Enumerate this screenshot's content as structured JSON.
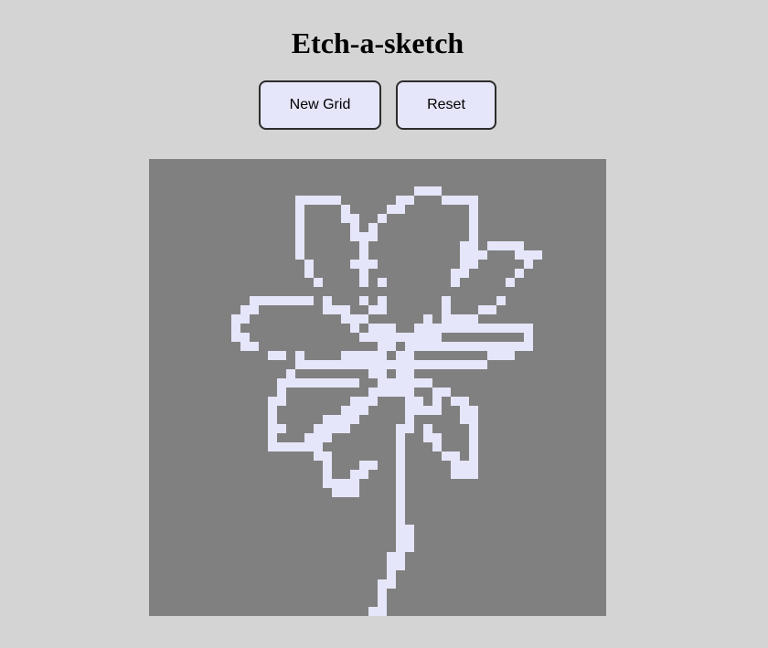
{
  "page": {
    "title": "Etch-a-sketch"
  },
  "controls": {
    "new_grid_label": "New Grid",
    "reset_label": "Reset"
  },
  "grid": {
    "columns": 50,
    "rows": 50,
    "background_color": "#808080",
    "ink_color": "#e6e6fa",
    "painted_cells": [
      [
        16,
        4
      ],
      [
        17,
        4
      ],
      [
        18,
        4
      ],
      [
        19,
        4
      ],
      [
        20,
        4
      ],
      [
        29,
        3
      ],
      [
        30,
        3
      ],
      [
        31,
        3
      ],
      [
        27,
        4
      ],
      [
        28,
        4
      ],
      [
        32,
        4
      ],
      [
        33,
        4
      ],
      [
        34,
        4
      ],
      [
        35,
        4
      ],
      [
        16,
        5
      ],
      [
        21,
        5
      ],
      [
        26,
        5
      ],
      [
        27,
        5
      ],
      [
        35,
        5
      ],
      [
        16,
        6
      ],
      [
        21,
        6
      ],
      [
        22,
        6
      ],
      [
        25,
        6
      ],
      [
        35,
        6
      ],
      [
        16,
        7
      ],
      [
        22,
        7
      ],
      [
        24,
        7
      ],
      [
        35,
        7
      ],
      [
        16,
        8
      ],
      [
        22,
        8
      ],
      [
        23,
        8
      ],
      [
        24,
        8
      ],
      [
        35,
        8
      ],
      [
        16,
        9
      ],
      [
        23,
        9
      ],
      [
        34,
        9
      ],
      [
        35,
        9
      ],
      [
        37,
        9
      ],
      [
        38,
        9
      ],
      [
        39,
        9
      ],
      [
        40,
        9
      ],
      [
        16,
        10
      ],
      [
        23,
        10
      ],
      [
        34,
        10
      ],
      [
        35,
        10
      ],
      [
        36,
        10
      ],
      [
        40,
        10
      ],
      [
        41,
        10
      ],
      [
        42,
        10
      ],
      [
        17,
        11
      ],
      [
        22,
        11
      ],
      [
        23,
        11
      ],
      [
        24,
        11
      ],
      [
        34,
        11
      ],
      [
        35,
        11
      ],
      [
        41,
        11
      ],
      [
        17,
        12
      ],
      [
        23,
        12
      ],
      [
        33,
        12
      ],
      [
        34,
        12
      ],
      [
        40,
        12
      ],
      [
        18,
        13
      ],
      [
        23,
        13
      ],
      [
        25,
        13
      ],
      [
        33,
        13
      ],
      [
        39,
        13
      ],
      [
        11,
        15
      ],
      [
        12,
        15
      ],
      [
        13,
        15
      ],
      [
        14,
        15
      ],
      [
        15,
        15
      ],
      [
        16,
        15
      ],
      [
        17,
        15
      ],
      [
        19,
        15
      ],
      [
        23,
        15
      ],
      [
        25,
        15
      ],
      [
        32,
        15
      ],
      [
        38,
        15
      ],
      [
        10,
        16
      ],
      [
        11,
        16
      ],
      [
        19,
        16
      ],
      [
        20,
        16
      ],
      [
        21,
        16
      ],
      [
        24,
        16
      ],
      [
        25,
        16
      ],
      [
        32,
        16
      ],
      [
        36,
        16
      ],
      [
        37,
        16
      ],
      [
        9,
        17
      ],
      [
        10,
        17
      ],
      [
        21,
        17
      ],
      [
        22,
        17
      ],
      [
        23,
        17
      ],
      [
        30,
        17
      ],
      [
        32,
        17
      ],
      [
        33,
        17
      ],
      [
        34,
        17
      ],
      [
        35,
        17
      ],
      [
        9,
        18
      ],
      [
        22,
        18
      ],
      [
        24,
        18
      ],
      [
        25,
        18
      ],
      [
        26,
        18
      ],
      [
        29,
        18
      ],
      [
        30,
        18
      ],
      [
        31,
        18
      ],
      [
        32,
        18
      ],
      [
        33,
        18
      ],
      [
        34,
        18
      ],
      [
        35,
        18
      ],
      [
        36,
        18
      ],
      [
        37,
        18
      ],
      [
        38,
        18
      ],
      [
        39,
        18
      ],
      [
        40,
        18
      ],
      [
        41,
        18
      ],
      [
        9,
        19
      ],
      [
        10,
        19
      ],
      [
        23,
        19
      ],
      [
        24,
        19
      ],
      [
        25,
        19
      ],
      [
        26,
        19
      ],
      [
        27,
        19
      ],
      [
        28,
        19
      ],
      [
        29,
        19
      ],
      [
        30,
        19
      ],
      [
        31,
        19
      ],
      [
        41,
        19
      ],
      [
        10,
        20
      ],
      [
        11,
        20
      ],
      [
        25,
        20
      ],
      [
        26,
        20
      ],
      [
        28,
        20
      ],
      [
        29,
        20
      ],
      [
        30,
        20
      ],
      [
        31,
        20
      ],
      [
        32,
        20
      ],
      [
        33,
        20
      ],
      [
        34,
        20
      ],
      [
        35,
        20
      ],
      [
        36,
        20
      ],
      [
        37,
        20
      ],
      [
        38,
        20
      ],
      [
        39,
        20
      ],
      [
        40,
        20
      ],
      [
        41,
        20
      ],
      [
        13,
        21
      ],
      [
        14,
        21
      ],
      [
        16,
        21
      ],
      [
        21,
        21
      ],
      [
        22,
        21
      ],
      [
        23,
        21
      ],
      [
        24,
        21
      ],
      [
        25,
        21
      ],
      [
        27,
        21
      ],
      [
        28,
        21
      ],
      [
        37,
        21
      ],
      [
        38,
        21
      ],
      [
        39,
        21
      ],
      [
        16,
        22
      ],
      [
        17,
        22
      ],
      [
        18,
        22
      ],
      [
        19,
        22
      ],
      [
        20,
        22
      ],
      [
        21,
        22
      ],
      [
        22,
        22
      ],
      [
        23,
        22
      ],
      [
        24,
        22
      ],
      [
        25,
        22
      ],
      [
        26,
        22
      ],
      [
        27,
        22
      ],
      [
        28,
        22
      ],
      [
        29,
        22
      ],
      [
        30,
        22
      ],
      [
        31,
        22
      ],
      [
        32,
        22
      ],
      [
        33,
        22
      ],
      [
        34,
        22
      ],
      [
        35,
        22
      ],
      [
        36,
        22
      ],
      [
        15,
        23
      ],
      [
        24,
        23
      ],
      [
        25,
        23
      ],
      [
        27,
        23
      ],
      [
        28,
        23
      ],
      [
        14,
        24
      ],
      [
        15,
        24
      ],
      [
        16,
        24
      ],
      [
        17,
        24
      ],
      [
        18,
        24
      ],
      [
        19,
        24
      ],
      [
        20,
        24
      ],
      [
        21,
        24
      ],
      [
        22,
        24
      ],
      [
        25,
        24
      ],
      [
        26,
        24
      ],
      [
        27,
        24
      ],
      [
        28,
        24
      ],
      [
        29,
        24
      ],
      [
        30,
        24
      ],
      [
        14,
        25
      ],
      [
        24,
        25
      ],
      [
        25,
        25
      ],
      [
        26,
        25
      ],
      [
        27,
        25
      ],
      [
        28,
        25
      ],
      [
        31,
        25
      ],
      [
        32,
        25
      ],
      [
        13,
        26
      ],
      [
        14,
        26
      ],
      [
        22,
        26
      ],
      [
        23,
        26
      ],
      [
        24,
        26
      ],
      [
        28,
        26
      ],
      [
        29,
        26
      ],
      [
        31,
        26
      ],
      [
        33,
        26
      ],
      [
        34,
        26
      ],
      [
        13,
        27
      ],
      [
        21,
        27
      ],
      [
        22,
        27
      ],
      [
        23,
        27
      ],
      [
        28,
        27
      ],
      [
        29,
        27
      ],
      [
        30,
        27
      ],
      [
        31,
        27
      ],
      [
        34,
        27
      ],
      [
        35,
        27
      ],
      [
        13,
        28
      ],
      [
        19,
        28
      ],
      [
        20,
        28
      ],
      [
        21,
        28
      ],
      [
        22,
        28
      ],
      [
        28,
        28
      ],
      [
        34,
        28
      ],
      [
        35,
        28
      ],
      [
        13,
        29
      ],
      [
        14,
        29
      ],
      [
        18,
        29
      ],
      [
        19,
        29
      ],
      [
        20,
        29
      ],
      [
        21,
        29
      ],
      [
        27,
        29
      ],
      [
        28,
        29
      ],
      [
        30,
        29
      ],
      [
        35,
        29
      ],
      [
        13,
        30
      ],
      [
        17,
        30
      ],
      [
        18,
        30
      ],
      [
        19,
        30
      ],
      [
        27,
        30
      ],
      [
        30,
        30
      ],
      [
        31,
        30
      ],
      [
        35,
        30
      ],
      [
        13,
        31
      ],
      [
        14,
        31
      ],
      [
        15,
        31
      ],
      [
        16,
        31
      ],
      [
        17,
        31
      ],
      [
        18,
        31
      ],
      [
        27,
        31
      ],
      [
        31,
        31
      ],
      [
        35,
        31
      ],
      [
        18,
        32
      ],
      [
        19,
        32
      ],
      [
        27,
        32
      ],
      [
        32,
        32
      ],
      [
        33,
        32
      ],
      [
        35,
        32
      ],
      [
        19,
        33
      ],
      [
        23,
        33
      ],
      [
        24,
        33
      ],
      [
        27,
        33
      ],
      [
        33,
        33
      ],
      [
        34,
        33
      ],
      [
        35,
        33
      ],
      [
        19,
        34
      ],
      [
        22,
        34
      ],
      [
        23,
        34
      ],
      [
        27,
        34
      ],
      [
        33,
        34
      ],
      [
        34,
        34
      ],
      [
        35,
        34
      ],
      [
        19,
        35
      ],
      [
        20,
        35
      ],
      [
        21,
        35
      ],
      [
        22,
        35
      ],
      [
        27,
        35
      ],
      [
        20,
        36
      ],
      [
        21,
        36
      ],
      [
        22,
        36
      ],
      [
        27,
        36
      ],
      [
        27,
        37
      ],
      [
        27,
        38
      ],
      [
        27,
        39
      ],
      [
        27,
        40
      ],
      [
        28,
        40
      ],
      [
        27,
        41
      ],
      [
        28,
        41
      ],
      [
        27,
        42
      ],
      [
        28,
        42
      ],
      [
        26,
        43
      ],
      [
        27,
        43
      ],
      [
        26,
        44
      ],
      [
        27,
        44
      ],
      [
        26,
        45
      ],
      [
        25,
        46
      ],
      [
        26,
        46
      ],
      [
        25,
        47
      ],
      [
        25,
        48
      ],
      [
        24,
        49
      ],
      [
        25,
        49
      ]
    ]
  }
}
